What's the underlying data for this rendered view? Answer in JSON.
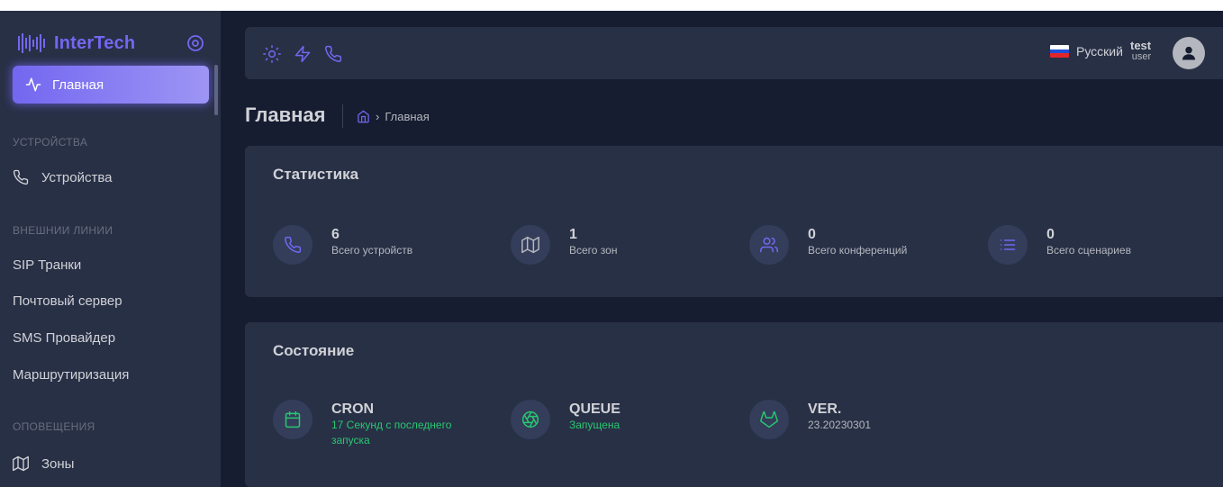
{
  "brand": {
    "name": "InterTech"
  },
  "sidebar": {
    "active_item": {
      "label": "Главная",
      "icon": "activity-icon"
    },
    "sections": [
      {
        "header": "УСТРОЙСТВА",
        "items": [
          {
            "label": "Устройства",
            "icon": "phone-icon"
          }
        ]
      },
      {
        "header": "ВНЕШНИИ ЛИНИИ",
        "items": [
          {
            "label": "SIP Транки"
          },
          {
            "label": "Почтовый сервер"
          },
          {
            "label": "SMS Провайдер"
          },
          {
            "label": "Маршрутиризация"
          }
        ]
      },
      {
        "header": "ОПОВЕЩЕНИЯ",
        "items": [
          {
            "label": "Зоны",
            "icon": "map-icon"
          }
        ]
      }
    ]
  },
  "topbar": {
    "icons": [
      "sun-icon",
      "zap-icon",
      "phone-icon"
    ],
    "language": "Русский",
    "user": {
      "name": "test",
      "role": "user"
    }
  },
  "page": {
    "title": "Главная",
    "breadcrumb": [
      "Главная"
    ]
  },
  "statistics": {
    "title": "Статистика",
    "items": [
      {
        "value": "6",
        "label": "Всего устройств",
        "icon": "phone-icon"
      },
      {
        "value": "1",
        "label": "Всего зон",
        "icon": "map-icon"
      },
      {
        "value": "0",
        "label": "Всего конференций",
        "icon": "users-icon"
      },
      {
        "value": "0",
        "label": "Всего сценариев",
        "icon": "list-icon"
      }
    ]
  },
  "status": {
    "title": "Состояние",
    "items": [
      {
        "value": "CRON",
        "label": "17 Секунд с последнего запуска",
        "icon": "calendar-icon",
        "label_color": "#28c76f"
      },
      {
        "value": "QUEUE",
        "label": "Запущена",
        "icon": "aperture-icon",
        "label_color": "#28c76f"
      },
      {
        "value": "VER.",
        "label": "23.20230301",
        "icon": "gitlab-icon"
      }
    ]
  },
  "colors": {
    "primary": "#7367f0",
    "success": "#28c76f",
    "background": "#161d31",
    "card": "#283046"
  }
}
